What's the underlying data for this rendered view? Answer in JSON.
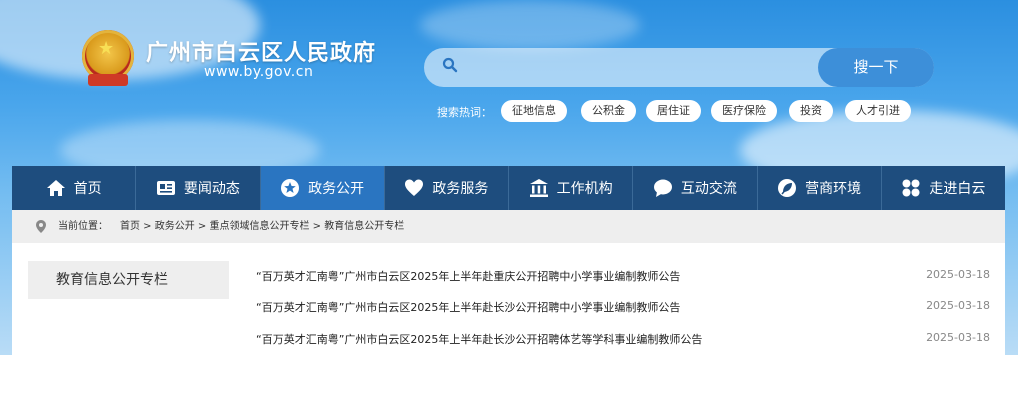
{
  "header": {
    "site_title": "广州市白云区人民政府",
    "site_url": "www.by.gov.cn"
  },
  "search": {
    "placeholder": "",
    "button_label": "搜一下",
    "hot_label": "搜索热词：",
    "hot_tags": [
      "征地信息",
      "公积金",
      "居住证",
      "医疗保险",
      "投资",
      "人才引进"
    ]
  },
  "nav": {
    "items": [
      {
        "label": "首页",
        "icon": "home-icon"
      },
      {
        "label": "要闻动态",
        "icon": "news-icon"
      },
      {
        "label": "政务公开",
        "icon": "star-icon",
        "active": true
      },
      {
        "label": "政务服务",
        "icon": "heart-icon"
      },
      {
        "label": "工作机构",
        "icon": "building-icon"
      },
      {
        "label": "互动交流",
        "icon": "chat-icon"
      },
      {
        "label": "营商环境",
        "icon": "leaf-icon"
      },
      {
        "label": "走进白云",
        "icon": "grid-icon"
      }
    ]
  },
  "breadcrumb": {
    "label": "当前位置：",
    "path": "首页 > 政务公开 > 重点领域信息公开专栏 > 教育信息公开专栏"
  },
  "sidebar": {
    "title": "教育信息公开专栏"
  },
  "news": [
    {
      "title": "“百万英才汇南粤”广州市白云区2025年上半年赴重庆公开招聘中小学事业编制教师公告",
      "date": "2025-03-18"
    },
    {
      "title": "“百万英才汇南粤”广州市白云区2025年上半年赴长沙公开招聘中小学事业编制教师公告",
      "date": "2025-03-18"
    },
    {
      "title": "“百万英才汇南粤”广州市白云区2025年上半年赴长沙公开招聘体艺等学科事业编制教师公告",
      "date": "2025-03-18"
    }
  ],
  "colors": {
    "nav_bg": "#1e4d7e",
    "nav_active": "#2a75c1",
    "search_button": "#3d8fd9",
    "breadcrumb_bg": "#eeeeee"
  }
}
